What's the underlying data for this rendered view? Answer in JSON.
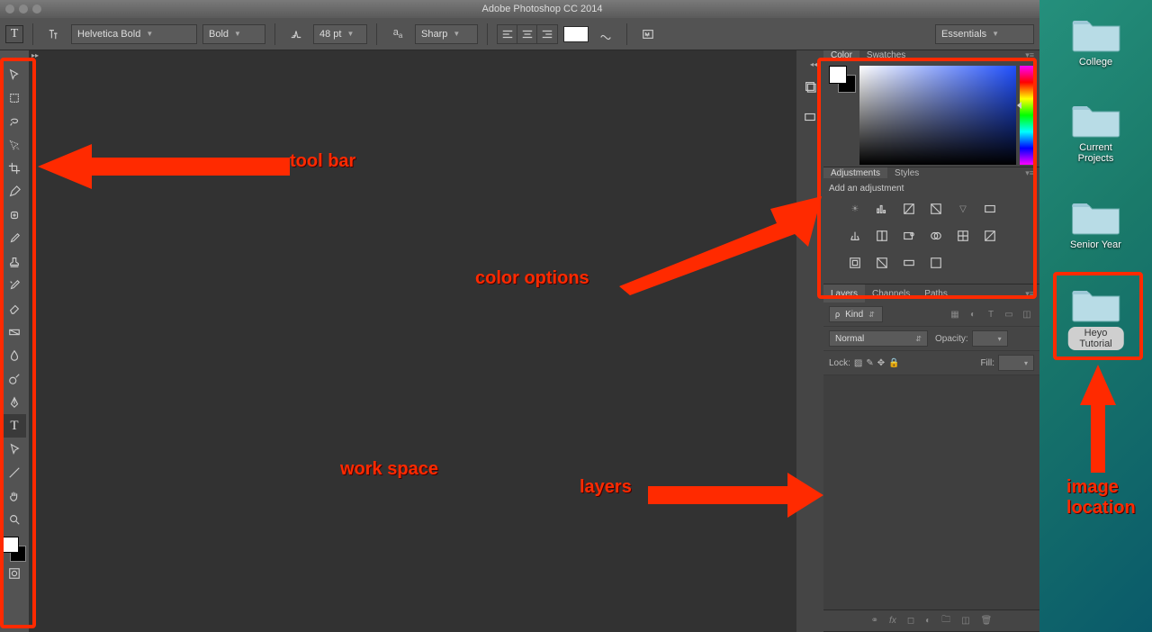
{
  "window": {
    "title": "Adobe Photoshop CC 2014"
  },
  "options": {
    "font": "Helvetica Bold",
    "weight": "Bold",
    "size": "48 pt",
    "aa": "Sharp",
    "workspace": "Essentials"
  },
  "tools": [
    {
      "name": "move-tool"
    },
    {
      "name": "marquee-tool"
    },
    {
      "name": "lasso-tool"
    },
    {
      "name": "quick-select-tool"
    },
    {
      "name": "crop-tool"
    },
    {
      "name": "eyedropper-tool"
    },
    {
      "name": "healing-brush-tool"
    },
    {
      "name": "brush-tool"
    },
    {
      "name": "stamp-tool"
    },
    {
      "name": "history-brush-tool"
    },
    {
      "name": "eraser-tool"
    },
    {
      "name": "gradient-tool"
    },
    {
      "name": "blur-tool"
    },
    {
      "name": "dodge-tool"
    },
    {
      "name": "pen-tool"
    },
    {
      "name": "type-tool"
    },
    {
      "name": "path-select-tool"
    },
    {
      "name": "line-tool"
    },
    {
      "name": "hand-tool"
    },
    {
      "name": "zoom-tool"
    }
  ],
  "panels": {
    "color": {
      "tab1": "Color",
      "tab2": "Swatches"
    },
    "adjustments": {
      "tab1": "Adjustments",
      "tab2": "Styles",
      "hint": "Add an adjustment"
    },
    "layers": {
      "tab1": "Layers",
      "tab2": "Channels",
      "tab3": "Paths",
      "kind": "Kind",
      "blend": "Normal",
      "opacity_label": "Opacity:",
      "lock_label": "Lock:",
      "fill_label": "Fill:"
    }
  },
  "desktop": {
    "folders": [
      {
        "label": "College",
        "selected": false
      },
      {
        "label": "Current Projects",
        "selected": false
      },
      {
        "label": "Senior Year",
        "selected": false
      },
      {
        "label": "Heyo Tutorial",
        "selected": true
      }
    ]
  },
  "callouts": {
    "toolbar": "tool bar",
    "color": "color options",
    "workspace": "work space",
    "layers": "layers",
    "image_loc": "image location"
  }
}
